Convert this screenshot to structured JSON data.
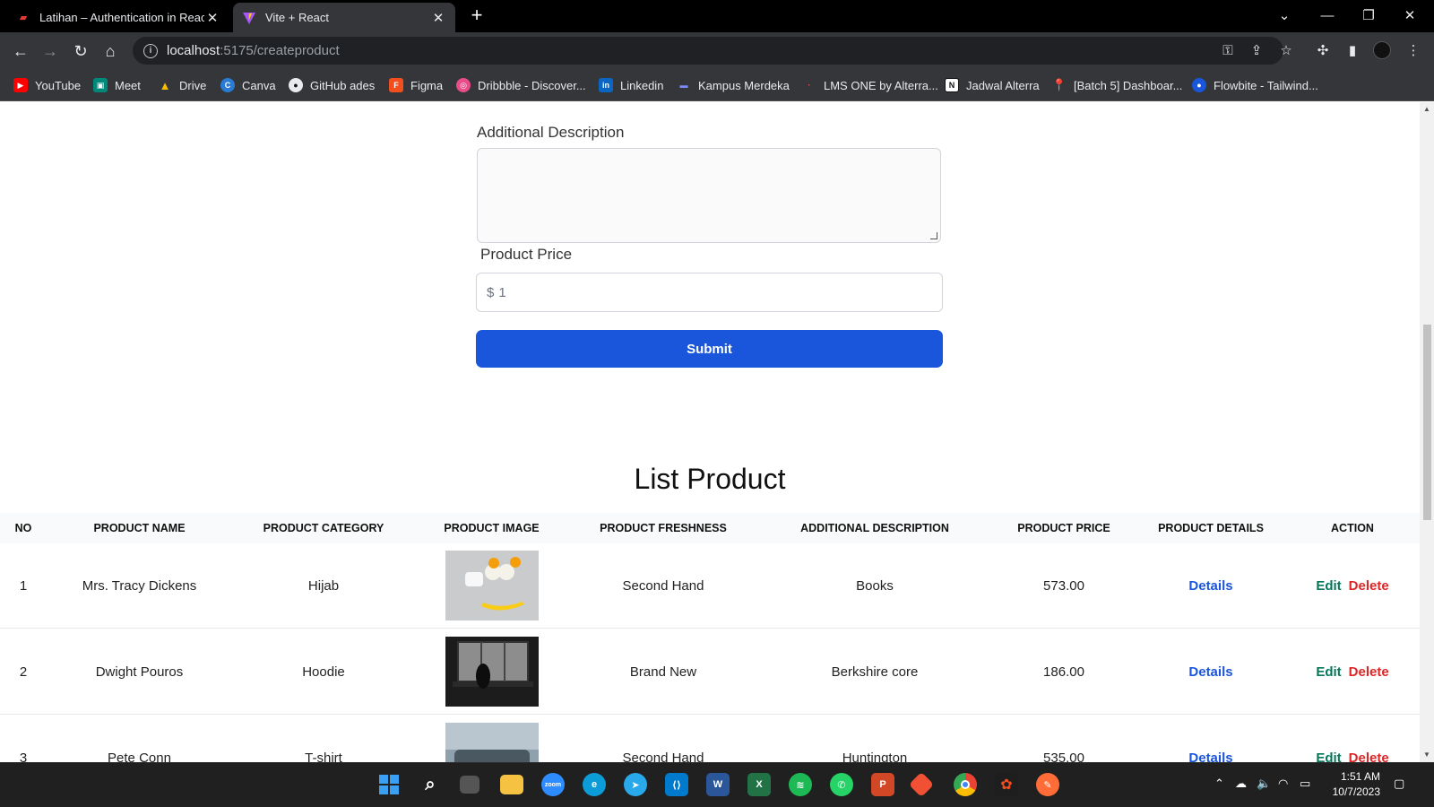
{
  "browser": {
    "tabs": [
      {
        "title": "Latihan – Authentication in Reac",
        "active": false
      },
      {
        "title": "Vite + React",
        "active": true
      }
    ],
    "url_host": "localhost",
    "url_path": ":5175/createproduct",
    "bookmarks": [
      {
        "label": "YouTube",
        "icon": "youtube-icon",
        "color": "#ff0000"
      },
      {
        "label": "Meet",
        "icon": "meet-icon",
        "color": "#00897b"
      },
      {
        "label": "Drive",
        "icon": "drive-icon",
        "color": "#fbbc04"
      },
      {
        "label": "Canva",
        "icon": "canva-icon",
        "color": "#2a7bd4"
      },
      {
        "label": "GitHub ades",
        "icon": "github-icon",
        "color": "#e8eaed"
      },
      {
        "label": "Figma",
        "icon": "figma-icon",
        "color": "#f24e1e"
      },
      {
        "label": "Dribbble - Discover...",
        "icon": "dribbble-icon",
        "color": "#ea4c89"
      },
      {
        "label": "Linkedin",
        "icon": "linkedin-icon",
        "color": "#0a66c2"
      },
      {
        "label": "Kampus Merdeka",
        "icon": "kampus-merdeka-icon",
        "color": "#3b5bdb"
      },
      {
        "label": "LMS ONE by Alterra...",
        "icon": "lms-icon",
        "color": "#ff4d4d"
      },
      {
        "label": "Jadwal Alterra",
        "icon": "notion-icon",
        "color": "#ffffff"
      },
      {
        "label": "[Batch 5] Dashboar...",
        "icon": "pin-icon",
        "color": "#e53935"
      },
      {
        "label": "Flowbite - Tailwind...",
        "icon": "flowbite-icon",
        "color": "#1a56db"
      }
    ]
  },
  "form": {
    "description_label": "Additional Description",
    "description_value": "",
    "price_label": "Product Price",
    "price_currency": "$",
    "price_value": "1",
    "submit_label": "Submit"
  },
  "list": {
    "title": "List Product",
    "columns": [
      "NO",
      "PRODUCT NAME",
      "PRODUCT CATEGORY",
      "PRODUCT IMAGE",
      "PRODUCT FRESHNESS",
      "ADDITIONAL DESCRIPTION",
      "PRODUCT PRICE",
      "PRODUCT DETAILS",
      "ACTION"
    ],
    "rows": [
      {
        "no": "1",
        "name": "Mrs. Tracy Dickens",
        "category": "Hijab",
        "image": "breakfast-food-photo",
        "freshness": "Second Hand",
        "description": "Books",
        "price": "573.00",
        "details": "Details",
        "edit": "Edit",
        "delete": "Delete"
      },
      {
        "no": "2",
        "name": "Dwight Pouros",
        "category": "Hoodie",
        "image": "dark-window-photo",
        "freshness": "Brand New",
        "description": "Berkshire core",
        "price": "186.00",
        "details": "Details",
        "edit": "Edit",
        "delete": "Delete"
      },
      {
        "no": "3",
        "name": "Pete Conn",
        "category": "T-shirt",
        "image": "car-interior-photo",
        "freshness": "Second Hand",
        "description": "Huntington",
        "price": "535.00",
        "details": "Details",
        "edit": "Edit",
        "delete": "Delete"
      }
    ]
  },
  "taskbar": {
    "apps": [
      "windows-start-icon",
      "search-icon",
      "task-view-icon",
      "file-explorer-icon",
      "zoom-icon",
      "edge-icon",
      "telegram-icon",
      "vscode-icon",
      "word-icon",
      "excel-icon",
      "spotify-icon",
      "whatsapp-icon",
      "powerpoint-icon",
      "git-icon",
      "chrome-icon",
      "figma-icon",
      "postman-icon"
    ],
    "time": "1:51 AM",
    "date": "10/7/2023"
  }
}
